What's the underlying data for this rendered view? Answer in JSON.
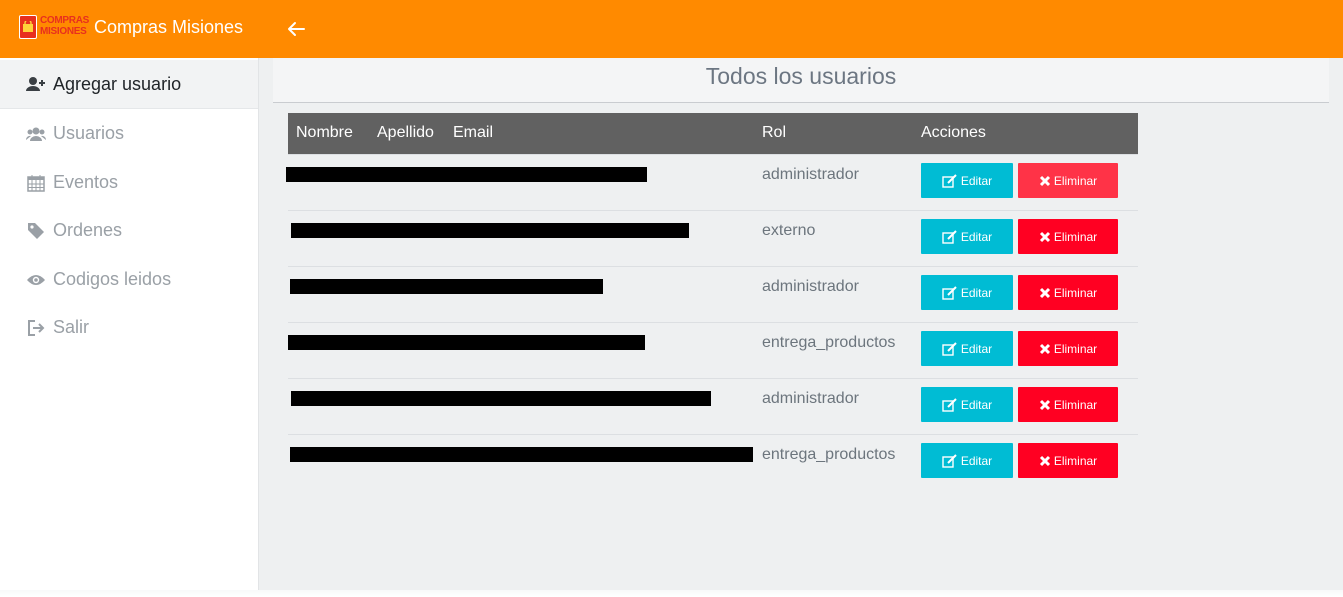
{
  "app": {
    "logo_line1": "COMPRAS",
    "logo_line2": "MISIONES",
    "title": "Compras Misiones"
  },
  "colors": {
    "topbar": "#ff8a00",
    "edit": "#00bcd4",
    "delete": "#ff0022",
    "table_header": "#616161"
  },
  "sidebar": {
    "items": [
      {
        "label": "Agregar usuario",
        "icon": "add-user-icon"
      },
      {
        "label": "Usuarios",
        "icon": "users-icon"
      },
      {
        "label": "Eventos",
        "icon": "calendar-icon"
      },
      {
        "label": "Ordenes",
        "icon": "tag-icon"
      },
      {
        "label": "Codigos leidos",
        "icon": "eye-icon"
      },
      {
        "label": "Salir",
        "icon": "sign-out-icon"
      }
    ]
  },
  "main": {
    "title": "Todos los usuarios",
    "columns": [
      "Nombre",
      "Apellido",
      "Email",
      "Rol",
      "Acciones"
    ],
    "edit_label": "Editar",
    "delete_label": "Eliminar",
    "rows": [
      {
        "rol": "administrador"
      },
      {
        "rol": "externo"
      },
      {
        "rol": "administrador"
      },
      {
        "rol": "entrega_productos"
      },
      {
        "rol": "administrador"
      },
      {
        "rol": "entrega_productos"
      }
    ]
  }
}
